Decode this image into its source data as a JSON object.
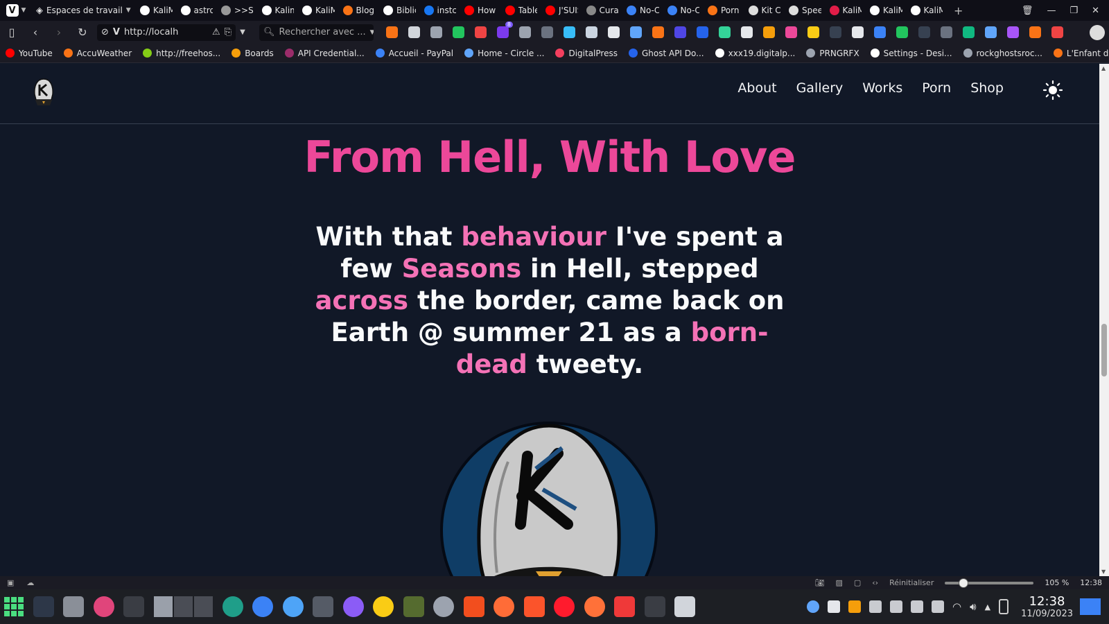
{
  "browser": {
    "workspace_label": "Espaces de travail",
    "tabs": [
      {
        "label": "KaliM",
        "color": "#ffffff"
      },
      {
        "label": "astro",
        "color": "#ffffff"
      },
      {
        "label": ">>Sta",
        "color": "#999999"
      },
      {
        "label": "Kalim",
        "color": "#ffffff"
      },
      {
        "label": "KaliM",
        "color": "#ffffff"
      },
      {
        "label": "Blog:",
        "color": "#f97316"
      },
      {
        "label": "Biblic",
        "color": "#ffffff"
      },
      {
        "label": "instc",
        "color": "#1877f2"
      },
      {
        "label": "How",
        "color": "#ff0000"
      },
      {
        "label": "Table",
        "color": "#ff0000"
      },
      {
        "label": "J'SUIS",
        "color": "#ff0000"
      },
      {
        "label": "Curat",
        "color": "#888888"
      },
      {
        "label": "No-C",
        "color": "#3b82f6"
      },
      {
        "label": "No-C",
        "color": "#3b82f6"
      },
      {
        "label": "Porn",
        "color": "#f97316"
      },
      {
        "label": "Kit Cc",
        "color": "#dddddd"
      },
      {
        "label": "Spee",
        "color": "#dddddd"
      },
      {
        "label": "KaliM",
        "color": "#e11d48"
      },
      {
        "label": "KaliM",
        "color": "#ffffff"
      },
      {
        "label": "KaliM",
        "color": "#ffffff"
      }
    ],
    "new_tab": "+",
    "url": "http://localh",
    "search_placeholder": "Rechercher avec ...",
    "bookmarks": [
      {
        "label": "YouTube",
        "color": "#ff0000"
      },
      {
        "label": "AccuWeather",
        "color": "#f97316"
      },
      {
        "label": "http://freehos...",
        "color": "#84cc16"
      },
      {
        "label": "Boards",
        "color": "#f59e0b"
      },
      {
        "label": "API Credential...",
        "color": "#9b2c6a"
      },
      {
        "label": "Accueil - PayPal",
        "color": "#3b82f6"
      },
      {
        "label": "Home - Circle ...",
        "color": "#60a5fa"
      },
      {
        "label": "DigitalPress",
        "color": "#f43f5e"
      },
      {
        "label": "Ghost API Do...",
        "color": "#2563eb"
      },
      {
        "label": "xxx19.digitalp...",
        "color": "#ffffff"
      },
      {
        "label": "PRNGRFX",
        "color": "#9ca3af"
      },
      {
        "label": "Settings - Desi...",
        "color": "#ffffff"
      },
      {
        "label": "rockghostsroc...",
        "color": "#9ca3af"
      },
      {
        "label": "L'Enfant du R...",
        "color": "#f97316"
      }
    ],
    "extension_badge": "8",
    "status": {
      "reset_label": "Réinitialiser",
      "zoom": "105 %",
      "time": "12:38"
    }
  },
  "site": {
    "nav": [
      "About",
      "Gallery",
      "Works",
      "Porn",
      "Shop"
    ],
    "title": "From Hell, With Love",
    "intro": [
      {
        "text": "With that ",
        "hl": false
      },
      {
        "text": "behaviour",
        "hl": true
      },
      {
        "text": " I've spent a few ",
        "hl": false
      },
      {
        "text": "Seasons",
        "hl": true
      },
      {
        "text": " in Hell, stepped ",
        "hl": false
      },
      {
        "text": "across",
        "hl": true
      },
      {
        "text": " the border, came back on Earth @ summer 21 as a ",
        "hl": false
      },
      {
        "text": "born-dead",
        "hl": true
      },
      {
        "text": " tweety.",
        "hl": false
      }
    ],
    "accent_color": "#ec4899",
    "background_color": "#111827"
  },
  "taskbar": {
    "apps": [
      {
        "name": "terminal",
        "color": "#2d3748",
        "shape": "sq"
      },
      {
        "name": "files",
        "color": "#8a8f98",
        "shape": "sq"
      },
      {
        "name": "downloader",
        "color": "#e0457b",
        "shape": "round"
      },
      {
        "name": "sublime",
        "color": "#3a3d44",
        "shape": "sq"
      },
      {
        "name": "shutter",
        "color": "#1f9e89",
        "shape": "round"
      },
      {
        "name": "browser-blue",
        "color": "#3b82f6",
        "shape": "round"
      },
      {
        "name": "bird",
        "color": "#4ea4f7",
        "shape": "round"
      },
      {
        "name": "inkscape",
        "color": "#555b66",
        "shape": "sq"
      },
      {
        "name": "crystal",
        "color": "#8b5cf6",
        "shape": "round"
      },
      {
        "name": "pastel",
        "color": "#facc15",
        "shape": "round"
      },
      {
        "name": "tank",
        "color": "#556b2f",
        "shape": "sq"
      },
      {
        "name": "settings",
        "color": "#9ca3af",
        "shape": "round"
      },
      {
        "name": "figma",
        "color": "#f24e1e",
        "shape": "sq"
      },
      {
        "name": "postman",
        "color": "#ff6c37",
        "shape": "round"
      },
      {
        "name": "brave",
        "color": "#fb542b",
        "shape": "sq"
      },
      {
        "name": "opera",
        "color": "#ff1b2d",
        "shape": "round"
      },
      {
        "name": "firefox",
        "color": "#ff7139",
        "shape": "round"
      },
      {
        "name": "vivaldi",
        "color": "#ef3939",
        "shape": "sq"
      },
      {
        "name": "terminal-green",
        "color": "#3a3d44",
        "shape": "sq"
      },
      {
        "name": "clipboard",
        "color": "#d1d5db",
        "shape": "sq"
      }
    ],
    "clock_time": "12:38",
    "clock_date": "11/09/2023"
  }
}
